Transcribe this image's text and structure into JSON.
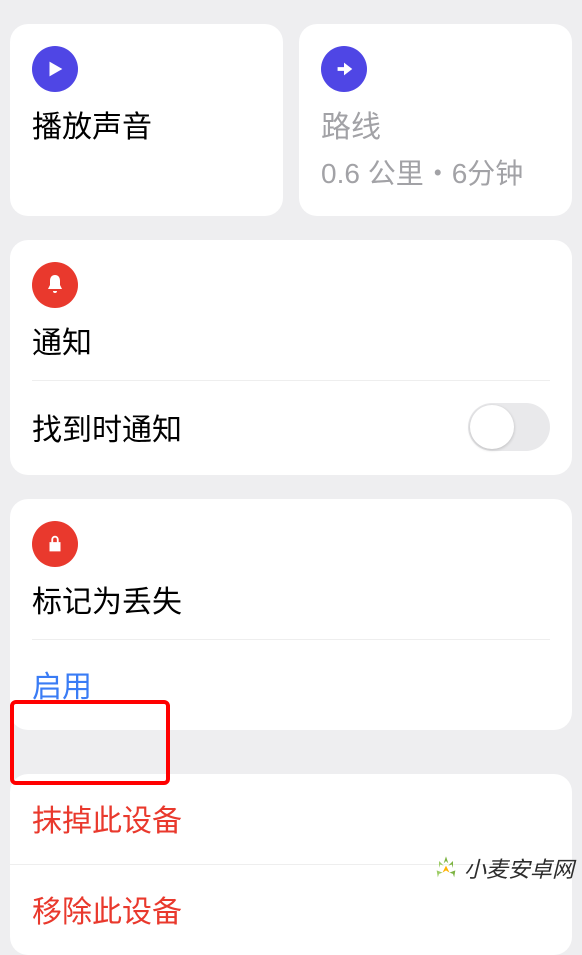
{
  "top": {
    "play": {
      "title": "播放声音"
    },
    "route": {
      "title": "路线",
      "sub": "0.6 公里・6分钟"
    }
  },
  "notify": {
    "title": "通知",
    "found": {
      "label": "找到时通知",
      "on": false
    }
  },
  "lost": {
    "title": "标记为丢失",
    "enable": "启用"
  },
  "danger": {
    "erase": "抹掉此设备",
    "remove": "移除此设备"
  },
  "watermark": "小麦安卓网"
}
